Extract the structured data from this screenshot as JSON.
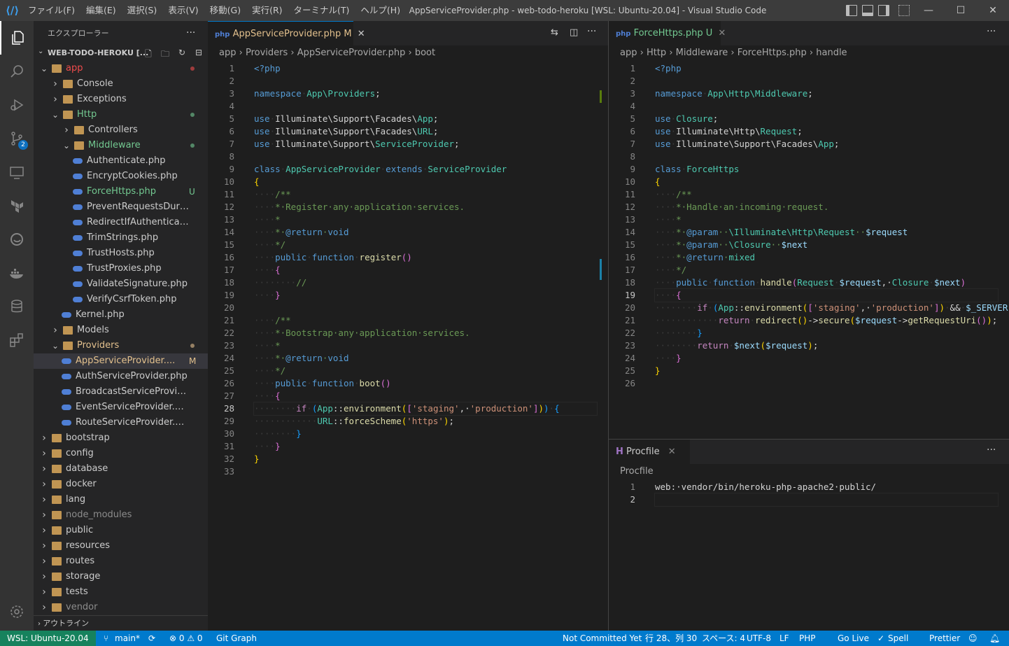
{
  "titlebar": {
    "menus": [
      "ファイル(F)",
      "編集(E)",
      "選択(S)",
      "表示(V)",
      "移動(G)",
      "実行(R)",
      "ターミナル(T)",
      "ヘルプ(H)"
    ],
    "window_title": "AppServiceProvider.php - web-todo-heroku [WSL: Ubuntu-20.04] - Visual Studio Code"
  },
  "sidebar": {
    "title": "エクスプローラー",
    "project": "WEB-TODO-HEROKU [...",
    "tree": [
      {
        "label": "app",
        "level": 0,
        "open": true,
        "color": "#f14c4c",
        "dot": true
      },
      {
        "label": "Console",
        "level": 1,
        "open": false
      },
      {
        "label": "Exceptions",
        "level": 1,
        "open": false
      },
      {
        "label": "Http",
        "level": 1,
        "open": true,
        "color": "#73c991",
        "dot": true
      },
      {
        "label": "Controllers",
        "level": 2,
        "open": false
      },
      {
        "label": "Middleware",
        "level": 2,
        "open": true,
        "color": "#73c991",
        "dot": true
      },
      {
        "label": "Authenticate.php",
        "level": 3,
        "file": true
      },
      {
        "label": "EncryptCookies.php",
        "level": 3,
        "file": true
      },
      {
        "label": "ForceHttps.php",
        "level": 3,
        "file": true,
        "color": "#73c991",
        "status": "U"
      },
      {
        "label": "PreventRequestsDuring...",
        "level": 3,
        "file": true
      },
      {
        "label": "RedirectIfAuthenticated...",
        "level": 3,
        "file": true
      },
      {
        "label": "TrimStrings.php",
        "level": 3,
        "file": true
      },
      {
        "label": "TrustHosts.php",
        "level": 3,
        "file": true
      },
      {
        "label": "TrustProxies.php",
        "level": 3,
        "file": true
      },
      {
        "label": "ValidateSignature.php",
        "level": 3,
        "file": true
      },
      {
        "label": "VerifyCsrfToken.php",
        "level": 3,
        "file": true
      },
      {
        "label": "Kernel.php",
        "level": 2,
        "file": true
      },
      {
        "label": "Models",
        "level": 1,
        "open": false
      },
      {
        "label": "Providers",
        "level": 1,
        "open": true,
        "color": "#e2c08d",
        "dot": true
      },
      {
        "label": "AppServiceProvider....",
        "level": 2,
        "file": true,
        "color": "#e2c08d",
        "status": "M",
        "selected": true
      },
      {
        "label": "AuthServiceProvider.php",
        "level": 2,
        "file": true
      },
      {
        "label": "BroadcastServiceProvider....",
        "level": 2,
        "file": true
      },
      {
        "label": "EventServiceProvider.php",
        "level": 2,
        "file": true
      },
      {
        "label": "RouteServiceProvider.php",
        "level": 2,
        "file": true
      },
      {
        "label": "bootstrap",
        "level": 0,
        "open": false
      },
      {
        "label": "config",
        "level": 0,
        "open": false
      },
      {
        "label": "database",
        "level": 0,
        "open": false
      },
      {
        "label": "docker",
        "level": 0,
        "open": false
      },
      {
        "label": "lang",
        "level": 0,
        "open": false
      },
      {
        "label": "node_modules",
        "level": 0,
        "open": false,
        "color": "#8c8c8c"
      },
      {
        "label": "public",
        "level": 0,
        "open": false
      },
      {
        "label": "resources",
        "level": 0,
        "open": false
      },
      {
        "label": "routes",
        "level": 0,
        "open": false
      },
      {
        "label": "storage",
        "level": 0,
        "open": false
      },
      {
        "label": "tests",
        "level": 0,
        "open": false
      },
      {
        "label": "vendor",
        "level": 0,
        "open": false,
        "color": "#8c8c8c"
      }
    ],
    "outline": "アウトライン"
  },
  "editor1": {
    "tab": {
      "label": "AppServiceProvider.php",
      "status": "M"
    },
    "breadcrumbs": [
      "app",
      "Providers",
      "AppServiceProvider.php",
      "boot"
    ],
    "current_line": 28,
    "lines": [
      [
        [
          "k",
          "<?php"
        ]
      ],
      [],
      [
        [
          "k",
          "namespace"
        ],
        [
          "ws",
          "·"
        ],
        [
          "t",
          "App\\Providers"
        ],
        [
          "p",
          ";"
        ]
      ],
      [],
      [
        [
          "k",
          "use"
        ],
        [
          "ws",
          "·"
        ],
        [
          "p",
          "Illuminate\\Support\\Facades\\"
        ],
        [
          "t",
          "App"
        ],
        [
          "p",
          ";"
        ]
      ],
      [
        [
          "k",
          "use"
        ],
        [
          "ws",
          "·"
        ],
        [
          "p",
          "Illuminate\\Support\\Facades\\"
        ],
        [
          "t",
          "URL"
        ],
        [
          "p",
          ";"
        ]
      ],
      [
        [
          "k",
          "use"
        ],
        [
          "ws",
          "·"
        ],
        [
          "p",
          "Illuminate\\Support\\"
        ],
        [
          "t",
          "ServiceProvider"
        ],
        [
          "p",
          ";"
        ]
      ],
      [],
      [
        [
          "k",
          "class"
        ],
        [
          "ws",
          "·"
        ],
        [
          "t",
          "AppServiceProvider"
        ],
        [
          "ws",
          "·"
        ],
        [
          "k",
          "extends"
        ],
        [
          "ws",
          "·"
        ],
        [
          "t",
          "ServiceProvider"
        ]
      ],
      [
        [
          "y",
          "{"
        ]
      ],
      [
        [
          "ws",
          "····"
        ],
        [
          "c",
          "/**"
        ]
      ],
      [
        [
          "ws",
          "····"
        ],
        [
          "c",
          "*·Register·any·application·services."
        ]
      ],
      [
        [
          "ws",
          "····"
        ],
        [
          "c",
          "*"
        ]
      ],
      [
        [
          "ws",
          "····"
        ],
        [
          "c",
          "*·"
        ],
        [
          "k",
          "@return"
        ],
        [
          "c",
          "·"
        ],
        [
          "k",
          "void"
        ]
      ],
      [
        [
          "ws",
          "····"
        ],
        [
          "c",
          "*/"
        ]
      ],
      [
        [
          "ws",
          "····"
        ],
        [
          "k",
          "public"
        ],
        [
          "ws",
          "·"
        ],
        [
          "k",
          "function"
        ],
        [
          "ws",
          "·"
        ],
        [
          "f",
          "register"
        ],
        [
          "pu",
          "()"
        ]
      ],
      [
        [
          "ws",
          "····"
        ],
        [
          "pu",
          "{"
        ]
      ],
      [
        [
          "ws",
          "········"
        ],
        [
          "c",
          "//"
        ]
      ],
      [
        [
          "ws",
          "····"
        ],
        [
          "pu",
          "}"
        ]
      ],
      [],
      [
        [
          "ws",
          "····"
        ],
        [
          "c",
          "/**"
        ]
      ],
      [
        [
          "ws",
          "····"
        ],
        [
          "c",
          "*·Bootstrap·any·application·services."
        ]
      ],
      [
        [
          "ws",
          "····"
        ],
        [
          "c",
          "*"
        ]
      ],
      [
        [
          "ws",
          "····"
        ],
        [
          "c",
          "*·"
        ],
        [
          "k",
          "@return"
        ],
        [
          "c",
          "·"
        ],
        [
          "k",
          "void"
        ]
      ],
      [
        [
          "ws",
          "····"
        ],
        [
          "c",
          "*/"
        ]
      ],
      [
        [
          "ws",
          "····"
        ],
        [
          "k",
          "public"
        ],
        [
          "ws",
          "·"
        ],
        [
          "k",
          "function"
        ],
        [
          "ws",
          "·"
        ],
        [
          "f",
          "boot"
        ],
        [
          "pu",
          "()"
        ]
      ],
      [
        [
          "ws",
          "····"
        ],
        [
          "pu",
          "{"
        ]
      ],
      [
        [
          "ws",
          "········"
        ],
        [
          "kc",
          "if"
        ],
        [
          "ws",
          "·"
        ],
        [
          "bl",
          "("
        ],
        [
          "t",
          "App"
        ],
        [
          "p",
          "::"
        ],
        [
          "f",
          "environment"
        ],
        [
          "y",
          "("
        ],
        [
          "pu",
          "["
        ],
        [
          "s",
          "'staging'"
        ],
        [
          "p",
          ",·"
        ],
        [
          "s",
          "'production'"
        ],
        [
          "pu",
          "]"
        ],
        [
          "y",
          ")"
        ],
        [
          "bl",
          ")"
        ],
        [
          "ws",
          "·"
        ],
        [
          "bl",
          "{"
        ]
      ],
      [
        [
          "ws",
          "············"
        ],
        [
          "t",
          "URL"
        ],
        [
          "p",
          "::"
        ],
        [
          "f",
          "forceScheme"
        ],
        [
          "y",
          "("
        ],
        [
          "s",
          "'https'"
        ],
        [
          "y",
          ")"
        ],
        [
          "p",
          ";"
        ]
      ],
      [
        [
          "ws",
          "········"
        ],
        [
          "bl",
          "}"
        ]
      ],
      [
        [
          "ws",
          "····"
        ],
        [
          "pu",
          "}"
        ]
      ],
      [
        [
          "y",
          "}"
        ]
      ],
      []
    ]
  },
  "editor2": {
    "tab": {
      "label": "ForceHttps.php",
      "status": "U"
    },
    "breadcrumbs": [
      "app",
      "Http",
      "Middleware",
      "ForceHttps.php",
      "handle"
    ],
    "current_line": 19,
    "lines": [
      [
        [
          "k",
          "<?php"
        ]
      ],
      [],
      [
        [
          "k",
          "namespace"
        ],
        [
          "ws",
          "·"
        ],
        [
          "t",
          "App\\Http\\Middleware"
        ],
        [
          "p",
          ";"
        ]
      ],
      [],
      [
        [
          "k",
          "use"
        ],
        [
          "ws",
          "·"
        ],
        [
          "t",
          "Closure"
        ],
        [
          "p",
          ";"
        ]
      ],
      [
        [
          "k",
          "use"
        ],
        [
          "ws",
          "·"
        ],
        [
          "p",
          "Illuminate\\Http\\"
        ],
        [
          "t",
          "Request"
        ],
        [
          "p",
          ";"
        ]
      ],
      [
        [
          "k",
          "use"
        ],
        [
          "ws",
          "·"
        ],
        [
          "p",
          "Illuminate\\Support\\Facades\\"
        ],
        [
          "t",
          "App"
        ],
        [
          "p",
          ";"
        ]
      ],
      [],
      [
        [
          "k",
          "class"
        ],
        [
          "ws",
          "·"
        ],
        [
          "t",
          "ForceHttps"
        ]
      ],
      [
        [
          "y",
          "{"
        ]
      ],
      [
        [
          "ws",
          "····"
        ],
        [
          "c",
          "/**"
        ]
      ],
      [
        [
          "ws",
          "····"
        ],
        [
          "c",
          "*·Handle·an·incoming·request."
        ]
      ],
      [
        [
          "ws",
          "····"
        ],
        [
          "c",
          "*"
        ]
      ],
      [
        [
          "ws",
          "····"
        ],
        [
          "c",
          "*·"
        ],
        [
          "k",
          "@param"
        ],
        [
          "c",
          "··"
        ],
        [
          "t",
          "\\Illuminate\\Http\\Request"
        ],
        [
          "c",
          "··"
        ],
        [
          "v",
          "$request"
        ]
      ],
      [
        [
          "ws",
          "····"
        ],
        [
          "c",
          "*·"
        ],
        [
          "k",
          "@param"
        ],
        [
          "c",
          "··"
        ],
        [
          "t",
          "\\Closure"
        ],
        [
          "c",
          "··"
        ],
        [
          "v",
          "$next"
        ]
      ],
      [
        [
          "ws",
          "····"
        ],
        [
          "c",
          "*·"
        ],
        [
          "k",
          "@return"
        ],
        [
          "c",
          "·"
        ],
        [
          "t",
          "mixed"
        ]
      ],
      [
        [
          "ws",
          "····"
        ],
        [
          "c",
          "*/"
        ]
      ],
      [
        [
          "ws",
          "····"
        ],
        [
          "k",
          "public"
        ],
        [
          "ws",
          "·"
        ],
        [
          "k",
          "function"
        ],
        [
          "ws",
          "·"
        ],
        [
          "f",
          "handle"
        ],
        [
          "pu",
          "("
        ],
        [
          "t",
          "Request"
        ],
        [
          "ws",
          "·"
        ],
        [
          "v",
          "$request"
        ],
        [
          "p",
          ",·"
        ],
        [
          "t",
          "Closure"
        ],
        [
          "ws",
          "·"
        ],
        [
          "v",
          "$next"
        ],
        [
          "pu",
          ")"
        ]
      ],
      [
        [
          "ws",
          "····"
        ],
        [
          "pu",
          "{"
        ]
      ],
      [
        [
          "ws",
          "········"
        ],
        [
          "kc",
          "if"
        ],
        [
          "ws",
          "·"
        ],
        [
          "bl",
          "("
        ],
        [
          "t",
          "App"
        ],
        [
          "p",
          "::"
        ],
        [
          "f",
          "environment"
        ],
        [
          "y",
          "("
        ],
        [
          "pu",
          "["
        ],
        [
          "s",
          "'staging'"
        ],
        [
          "p",
          ",·"
        ],
        [
          "s",
          "'production'"
        ],
        [
          "pu",
          "]"
        ],
        [
          "y",
          ")"
        ],
        [
          "ws",
          "·"
        ],
        [
          "p",
          "&&"
        ],
        [
          "ws",
          "·"
        ],
        [
          "v",
          "$_SERVER"
        ],
        [
          "y",
          "["
        ],
        [
          "s",
          "'"
        ]
      ],
      [
        [
          "ws",
          "············"
        ],
        [
          "kc",
          "return"
        ],
        [
          "ws",
          "·"
        ],
        [
          "f",
          "redirect"
        ],
        [
          "y",
          "()"
        ],
        [
          "p",
          "->"
        ],
        [
          "f",
          "secure"
        ],
        [
          "y",
          "("
        ],
        [
          "v",
          "$request"
        ],
        [
          "p",
          "->"
        ],
        [
          "f",
          "getRequestUri"
        ],
        [
          "pu",
          "()"
        ],
        [
          "y",
          ")"
        ],
        [
          "p",
          ";"
        ]
      ],
      [
        [
          "ws",
          "········"
        ],
        [
          "bl",
          "}"
        ]
      ],
      [
        [
          "ws",
          "········"
        ],
        [
          "kc",
          "return"
        ],
        [
          "ws",
          "·"
        ],
        [
          "v",
          "$next"
        ],
        [
          "y",
          "("
        ],
        [
          "v",
          "$request"
        ],
        [
          "y",
          ")"
        ],
        [
          "p",
          ";"
        ]
      ],
      [
        [
          "ws",
          "····"
        ],
        [
          "pu",
          "}"
        ]
      ],
      [
        [
          "y",
          "}"
        ]
      ],
      []
    ]
  },
  "editor3": {
    "tab": {
      "label": "Procfile"
    },
    "breadcrumbs": [
      "Procfile"
    ],
    "current_line": 2,
    "lines": [
      [
        [
          "p",
          "web:·vendor/bin/heroku-php-apache2·public/"
        ]
      ],
      []
    ]
  },
  "statusbar": {
    "remote": "WSL: Ubuntu-20.04",
    "branch": "main*",
    "problems": "⊗ 0 ⚠ 0",
    "gitgraph": "Git Graph",
    "commit": "Not Committed Yet",
    "position": "行 28、列 30",
    "spaces": "スペース: 4",
    "encoding": "UTF-8",
    "eol": "LF",
    "language": "PHP",
    "golive": "Go Live",
    "spell": "Spell",
    "prettier": "Prettier"
  },
  "colors": {
    "accent": "#007acc",
    "remote": "#16825d"
  }
}
